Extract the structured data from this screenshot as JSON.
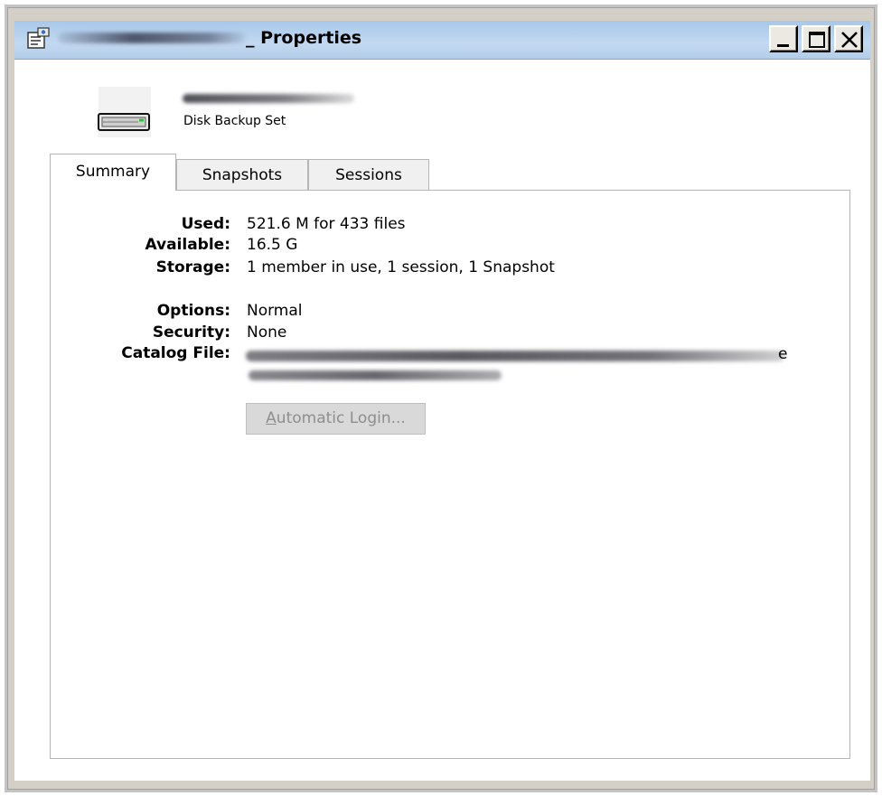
{
  "window": {
    "title_suffix": "_ Properties",
    "icon": "properties-icon",
    "caption_buttons": [
      "minimize-icon",
      "maximize-icon",
      "close-icon"
    ]
  },
  "header": {
    "set_type": "Disk Backup Set",
    "icon": "disk-drive-icon"
  },
  "tabs": [
    {
      "label": "Summary",
      "selected": true
    },
    {
      "label": "Snapshots",
      "selected": false
    },
    {
      "label": "Sessions",
      "selected": false
    }
  ],
  "summary": {
    "used_label": "Used:",
    "used_value": "521.6 M for 433 files",
    "available_label": "Available:",
    "available_value": "16.5 G",
    "storage_label": "Storage:",
    "storage_value": "1 member in use, 1 session, 1 Snapshot",
    "options_label": "Options:",
    "options_value": "Normal",
    "security_label": "Security:",
    "security_value": "None",
    "catalog_label": "Catalog File:",
    "catalog_tail": "e"
  },
  "buttons": {
    "auto_login_accel": "A",
    "auto_login_rest": "utomatic Login..."
  }
}
